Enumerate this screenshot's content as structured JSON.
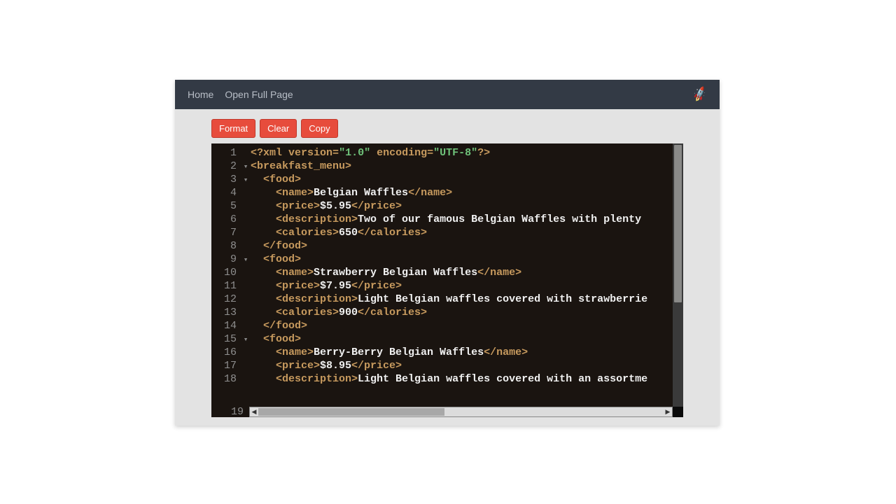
{
  "nav": {
    "home": "Home",
    "open_full": "Open Full Page"
  },
  "toolbar": {
    "format": "Format",
    "clear": "Clear",
    "copy": "Copy"
  },
  "icons": {
    "rocket": "🚀"
  },
  "editor": {
    "last_line_number": "19",
    "lines": [
      {
        "n": 1,
        "fold": "",
        "tokens": [
          [
            "decl",
            "<?"
          ],
          [
            "tag",
            "xml "
          ],
          [
            "attr",
            "version"
          ],
          [
            "decl",
            "="
          ],
          [
            "str",
            "\"1.0\""
          ],
          [
            "decl",
            " "
          ],
          [
            "attr",
            "encoding"
          ],
          [
            "decl",
            "="
          ],
          [
            "str",
            "\"UTF-8\""
          ],
          [
            "decl",
            "?>"
          ]
        ]
      },
      {
        "n": 2,
        "fold": "▾",
        "tokens": [
          [
            "tag",
            "<breakfast_menu>"
          ]
        ]
      },
      {
        "n": 3,
        "fold": "▾",
        "tokens": [
          [
            "txt",
            "  "
          ],
          [
            "tag",
            "<food>"
          ]
        ]
      },
      {
        "n": 4,
        "fold": "",
        "tokens": [
          [
            "txt",
            "    "
          ],
          [
            "tag",
            "<name>"
          ],
          [
            "txt",
            "Belgian Waffles"
          ],
          [
            "tag",
            "</name>"
          ]
        ]
      },
      {
        "n": 5,
        "fold": "",
        "tokens": [
          [
            "txt",
            "    "
          ],
          [
            "tag",
            "<price>"
          ],
          [
            "txt",
            "$5.95"
          ],
          [
            "tag",
            "</price>"
          ]
        ]
      },
      {
        "n": 6,
        "fold": "",
        "tokens": [
          [
            "txt",
            "    "
          ],
          [
            "tag",
            "<description>"
          ],
          [
            "txt",
            "Two of our famous Belgian Waffles with plenty "
          ]
        ]
      },
      {
        "n": 7,
        "fold": "",
        "tokens": [
          [
            "txt",
            "    "
          ],
          [
            "tag",
            "<calories>"
          ],
          [
            "txt",
            "650"
          ],
          [
            "tag",
            "</calories>"
          ]
        ]
      },
      {
        "n": 8,
        "fold": "",
        "tokens": [
          [
            "txt",
            "  "
          ],
          [
            "tag",
            "</food>"
          ]
        ]
      },
      {
        "n": 9,
        "fold": "▾",
        "tokens": [
          [
            "txt",
            "  "
          ],
          [
            "tag",
            "<food>"
          ]
        ]
      },
      {
        "n": 10,
        "fold": "",
        "tokens": [
          [
            "txt",
            "    "
          ],
          [
            "tag",
            "<name>"
          ],
          [
            "txt",
            "Strawberry Belgian Waffles"
          ],
          [
            "tag",
            "</name>"
          ]
        ]
      },
      {
        "n": 11,
        "fold": "",
        "tokens": [
          [
            "txt",
            "    "
          ],
          [
            "tag",
            "<price>"
          ],
          [
            "txt",
            "$7.95"
          ],
          [
            "tag",
            "</price>"
          ]
        ]
      },
      {
        "n": 12,
        "fold": "",
        "tokens": [
          [
            "txt",
            "    "
          ],
          [
            "tag",
            "<description>"
          ],
          [
            "txt",
            "Light Belgian waffles covered with strawberrie"
          ]
        ]
      },
      {
        "n": 13,
        "fold": "",
        "tokens": [
          [
            "txt",
            "    "
          ],
          [
            "tag",
            "<calories>"
          ],
          [
            "txt",
            "900"
          ],
          [
            "tag",
            "</calories>"
          ]
        ]
      },
      {
        "n": 14,
        "fold": "",
        "tokens": [
          [
            "txt",
            "  "
          ],
          [
            "tag",
            "</food>"
          ]
        ]
      },
      {
        "n": 15,
        "fold": "▾",
        "tokens": [
          [
            "txt",
            "  "
          ],
          [
            "tag",
            "<food>"
          ]
        ]
      },
      {
        "n": 16,
        "fold": "",
        "tokens": [
          [
            "txt",
            "    "
          ],
          [
            "tag",
            "<name>"
          ],
          [
            "txt",
            "Berry-Berry Belgian Waffles"
          ],
          [
            "tag",
            "</name>"
          ]
        ]
      },
      {
        "n": 17,
        "fold": "",
        "tokens": [
          [
            "txt",
            "    "
          ],
          [
            "tag",
            "<price>"
          ],
          [
            "txt",
            "$8.95"
          ],
          [
            "tag",
            "</price>"
          ]
        ]
      },
      {
        "n": 18,
        "fold": "",
        "tokens": [
          [
            "txt",
            "    "
          ],
          [
            "tag",
            "<description>"
          ],
          [
            "txt",
            "Light Belgian waffles covered with an assortme"
          ]
        ]
      }
    ]
  }
}
